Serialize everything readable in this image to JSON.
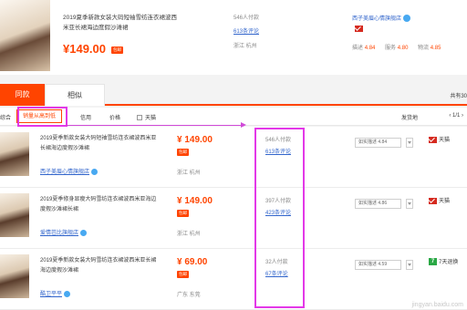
{
  "top_item": {
    "title": "2019夏季新款女装大码短袖雪纺连衣裙波西米亚长裙海边度假沙滩裙",
    "price": "¥149.00",
    "badge": "包邮",
    "sales": "546人付款",
    "comments": "613条评论",
    "location": "浙江 杭州",
    "shop": "西子美眉心情旗舰店",
    "scores": [
      {
        "label": "描述",
        "value": "4.84"
      },
      {
        "label": "服务",
        "value": "4.80"
      },
      {
        "label": "物流",
        "value": "4.85"
      }
    ]
  },
  "tabs": {
    "same": "同款",
    "similar": "相似"
  },
  "total": "共有30",
  "filter": {
    "sort_default": "综合",
    "sort_sales": "销量从高到低",
    "credit": "信用",
    "price": "价格",
    "tmall": "天猫",
    "shipping": "发货地",
    "page": "1/1"
  },
  "rows": [
    {
      "title": "2019夏季新款女装大码短袖雪纺连衣裙波西米亚长裙海边度假沙滩裙",
      "shop": "西子美眉心情旗舰店",
      "price": "¥ 149.00",
      "badge": "包邮",
      "location": "浙江 杭州",
      "sales": "546人付款",
      "comments": "613条评论",
      "sort": "如实描述 4.84",
      "service": "天猫",
      "service_type": "tmall"
    },
    {
      "title": "2019夏季修身显瘦大码雪纺连衣裙波西米亚海边度假沙滩裙长裙",
      "shop": "爱情芭比旗舰店",
      "price": "¥ 149.00",
      "badge": "包邮",
      "location": "浙江 杭州",
      "sales": "397人付款",
      "comments": "423条评论",
      "sort": "如实描述 4.86",
      "service": "天猫",
      "service_type": "tmall"
    },
    {
      "title": "2019夏季新款女装大码雪纺连衣裙波西米亚长裙海边度假沙滩裙",
      "shop": "酷卫平平",
      "price": "¥ 69.00",
      "badge": "包邮",
      "location": "广东 东莞",
      "sales": "32人付款",
      "comments": "67条评论",
      "sort": "如实描述 4.59",
      "service": "7天退换",
      "service_type": "seven"
    }
  ],
  "watermark": "jingyan.baidu.com",
  "colors": {
    "accent": "#ff4400",
    "highlight": "#e338e8",
    "link": "#3366cc"
  }
}
